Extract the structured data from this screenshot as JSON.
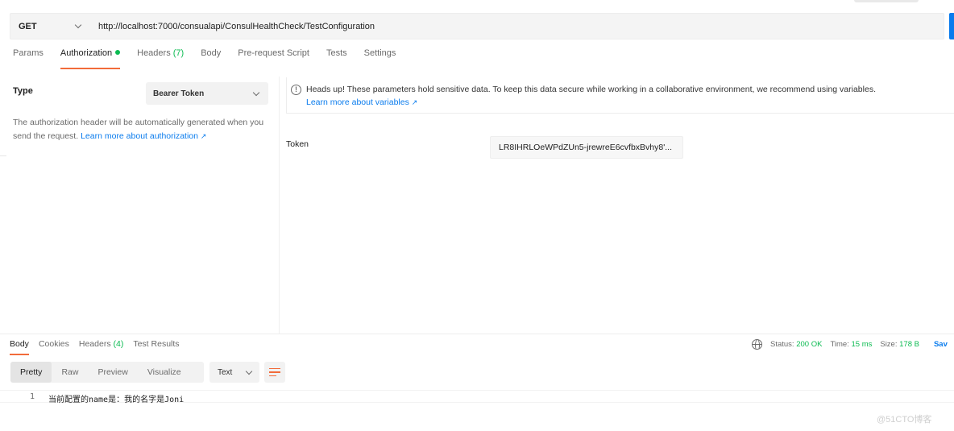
{
  "request": {
    "method": "GET",
    "url": "http://localhost:7000/consualapi/ConsulHealthCheck/TestConfiguration"
  },
  "request_tabs": [
    {
      "label": "Params"
    },
    {
      "label": "Authorization"
    },
    {
      "label": "Headers",
      "count": "(7)"
    },
    {
      "label": "Body"
    },
    {
      "label": "Pre-request Script"
    },
    {
      "label": "Tests"
    },
    {
      "label": "Settings"
    }
  ],
  "auth": {
    "type_label": "Type",
    "type_value": "Bearer Token",
    "description": "The authorization header will be automatically generated when you send the request.",
    "learn_more": "Learn more about authorization",
    "notice": "Heads up! These parameters hold sensitive data. To keep this data secure while working in a collaborative environment, we recommend using variables.",
    "notice_link": "Learn more about variables",
    "token_label": "Token",
    "token_value": "LR8IHRLOeWPdZUn5-jrewreE6cvfbxBvhy8'..."
  },
  "response_tabs": [
    {
      "label": "Body"
    },
    {
      "label": "Cookies"
    },
    {
      "label": "Headers",
      "count": "(4)"
    },
    {
      "label": "Test Results"
    }
  ],
  "status": {
    "status_label": "Status:",
    "status_value": "200 OK",
    "time_label": "Time:",
    "time_value": "15 ms",
    "size_label": "Size:",
    "size_value": "178 B",
    "save": "Sav"
  },
  "format_tabs": [
    "Pretty",
    "Raw",
    "Preview",
    "Visualize"
  ],
  "language": "Text",
  "response_body": {
    "line_number": "1",
    "text": "当前配置的name是：我的名字是Joni"
  },
  "watermark": "@51CTO博客",
  "colors": {
    "accent": "#f26b3a",
    "link": "#097bed",
    "success": "#0cbb52"
  }
}
